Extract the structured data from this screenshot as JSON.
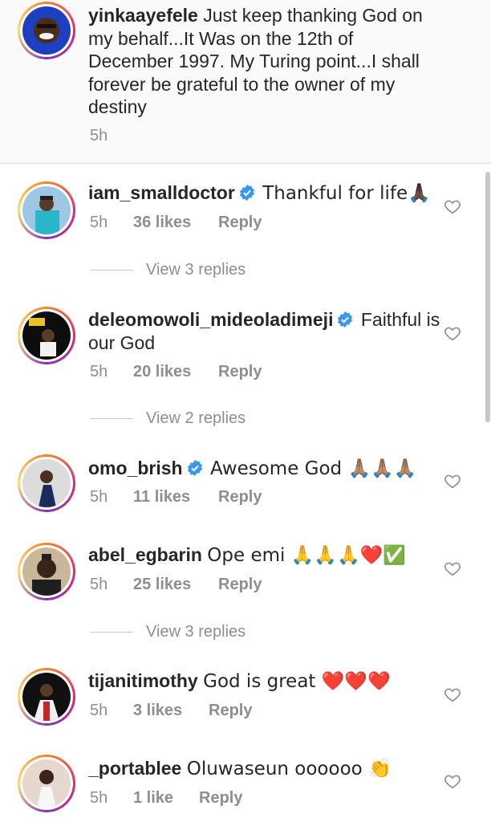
{
  "caption": {
    "username": "yinkaayefele",
    "text": "Just keep thanking God on my behalf...It Was on the 12th of December 1997. My Turing point...I shall forever be grateful to the owner of my destiny",
    "time": "5h"
  },
  "comments": [
    {
      "username": "iam_smalldoctor",
      "verified": true,
      "text": "Thankful for life🙏🏿",
      "time": "5h",
      "likes": "36 likes",
      "reply_label": "Reply",
      "view_replies": "View 3 replies"
    },
    {
      "username": "deleomowoli_mideoladimeji",
      "verified": true,
      "text": "Faithful is our God",
      "time": "5h",
      "likes": "20 likes",
      "reply_label": "Reply",
      "view_replies": "View 2 replies"
    },
    {
      "username": "omo_brish",
      "verified": true,
      "text": "Awesome God 🙏🏽🙏🏽🙏🏽",
      "time": "5h",
      "likes": "11 likes",
      "reply_label": "Reply"
    },
    {
      "username": "abel_egbarin",
      "verified": false,
      "text": "Ope emi 🙏🙏🙏❤️✅",
      "time": "5h",
      "likes": "25 likes",
      "reply_label": "Reply",
      "view_replies": "View 3 replies"
    },
    {
      "username": "tijanitimothy",
      "verified": false,
      "text": "God is great ❤️❤️❤️",
      "time": "5h",
      "likes": "3 likes",
      "reply_label": "Reply"
    },
    {
      "username": "_portablee",
      "verified": false,
      "text": "Oluwaseun oooooo 👏",
      "time": "5h",
      "likes": "1 like",
      "reply_label": "Reply"
    }
  ],
  "colors": {
    "verified_blue": "#3897f0",
    "meta_gray": "#8e8e8e",
    "text": "#262626"
  },
  "icons": [
    "verified-badge-icon",
    "heart-outline-icon"
  ]
}
